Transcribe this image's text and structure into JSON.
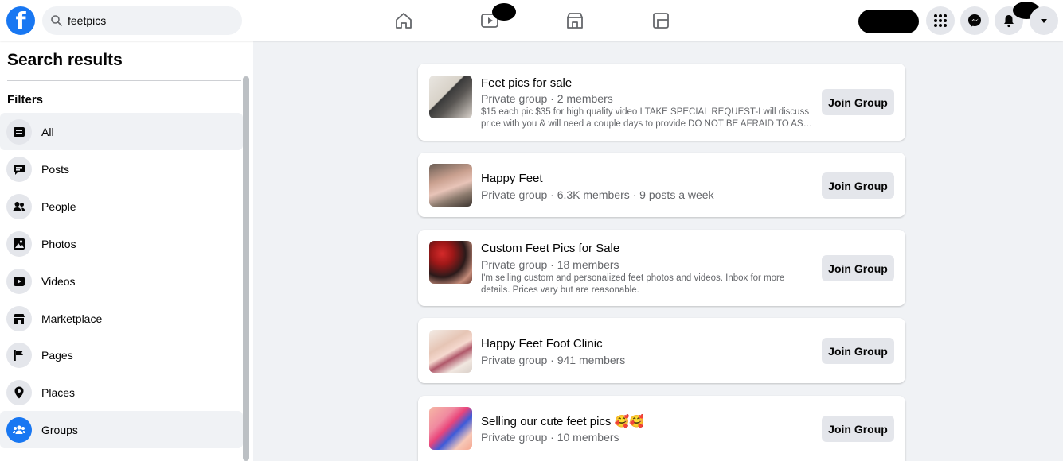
{
  "search": {
    "query": "feetpics"
  },
  "sidebar": {
    "title": "Search results",
    "filters_label": "Filters",
    "items": [
      {
        "label": "All",
        "icon": "all-results-icon"
      },
      {
        "label": "Posts",
        "icon": "posts-icon"
      },
      {
        "label": "People",
        "icon": "people-icon"
      },
      {
        "label": "Photos",
        "icon": "photos-icon"
      },
      {
        "label": "Videos",
        "icon": "videos-icon"
      },
      {
        "label": "Marketplace",
        "icon": "marketplace-icon"
      },
      {
        "label": "Pages",
        "icon": "pages-flag-icon"
      },
      {
        "label": "Places",
        "icon": "places-pin-icon"
      },
      {
        "label": "Groups",
        "icon": "groups-icon"
      }
    ]
  },
  "results": [
    {
      "title": "Feet pics for sale",
      "meta": "Private group · 2 members",
      "desc": "$15 each pic $35 for high quality video I TAKE SPECIAL REQUEST-I will discuss price with you & will need a couple days to provide DO NOT BE AFRAID TO AS…",
      "join_label": "Join Group"
    },
    {
      "title": "Happy Feet",
      "meta": "Private group · 6.3K members · 9 posts a week",
      "join_label": "Join Group"
    },
    {
      "title": "Custom Feet Pics for Sale",
      "meta": "Private group · 18 members",
      "desc": "I'm selling custom and personalized feet photos and videos. Inbox for more details. Prices vary but are reasonable.",
      "join_label": "Join Group"
    },
    {
      "title": "Happy Feet Foot Clinic",
      "meta": "Private group · 941 members",
      "join_label": "Join Group"
    },
    {
      "title": "Selling our cute feet pics 🥰🥰",
      "meta": "Private group · 10 members",
      "join_label": "Join Group"
    }
  ],
  "colors": {
    "brand": "#1877f2",
    "background": "#f0f2f5",
    "secondary_text": "#65676b"
  }
}
